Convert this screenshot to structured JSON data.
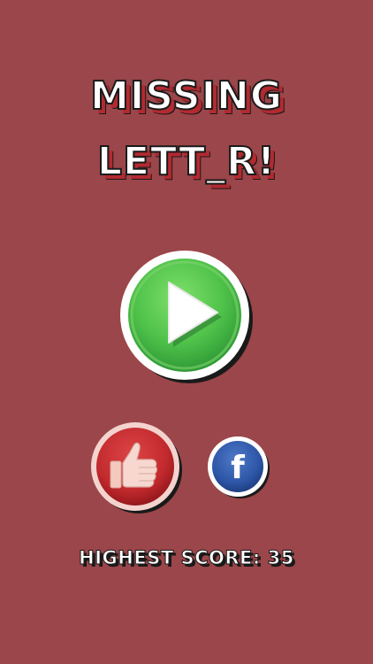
{
  "title": {
    "line1": "MISSING",
    "line2": "LETT_R!"
  },
  "buttons": {
    "play_icon": "play-icon",
    "like_icon": "thumbs-up-icon",
    "facebook_icon": "facebook-icon"
  },
  "score": {
    "label": "HIGHEST SCORE:",
    "value": "35"
  },
  "colors": {
    "background": "#9b464a",
    "play_green": "#4fc24a",
    "like_red": "#c22a2e",
    "facebook_blue": "#2e57a8",
    "title_shadow": "#b22a30"
  }
}
